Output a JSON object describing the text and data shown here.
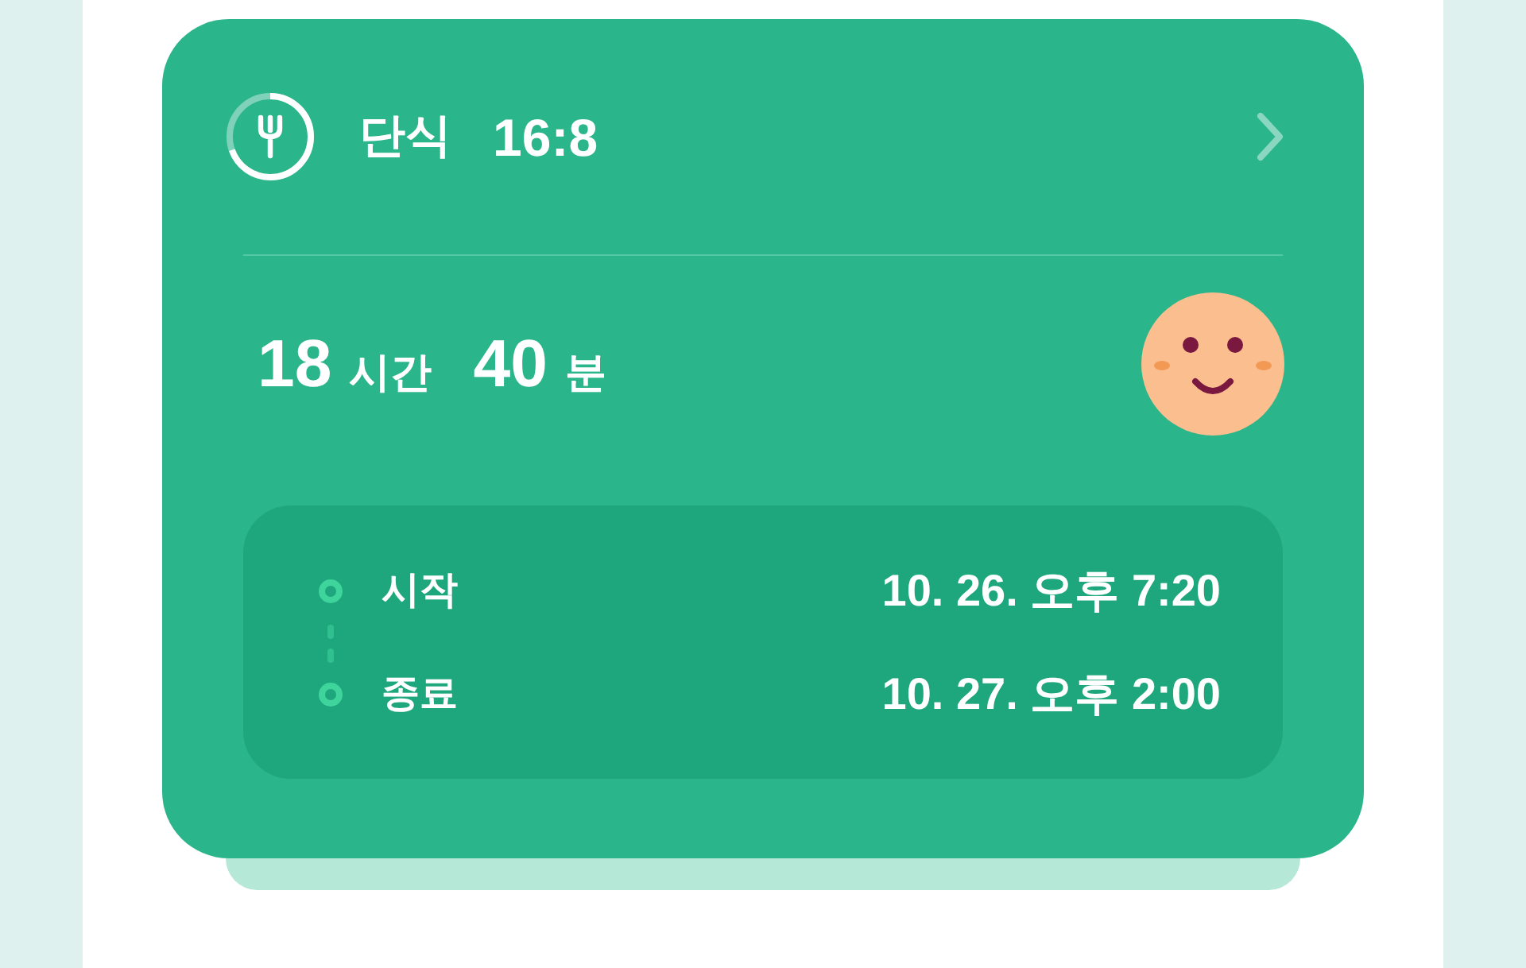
{
  "header": {
    "title": "단식",
    "plan": "16:8",
    "level": 0.7
  },
  "elapsed": {
    "hours": "18",
    "hours_unit": "시간",
    "minutes": "40",
    "minutes_unit": "분"
  },
  "timeline": [
    {
      "label": "시작",
      "time": "10. 26. 오후 7:20"
    },
    {
      "label": "종료",
      "time": "10. 27. 오후 2:00"
    }
  ]
}
